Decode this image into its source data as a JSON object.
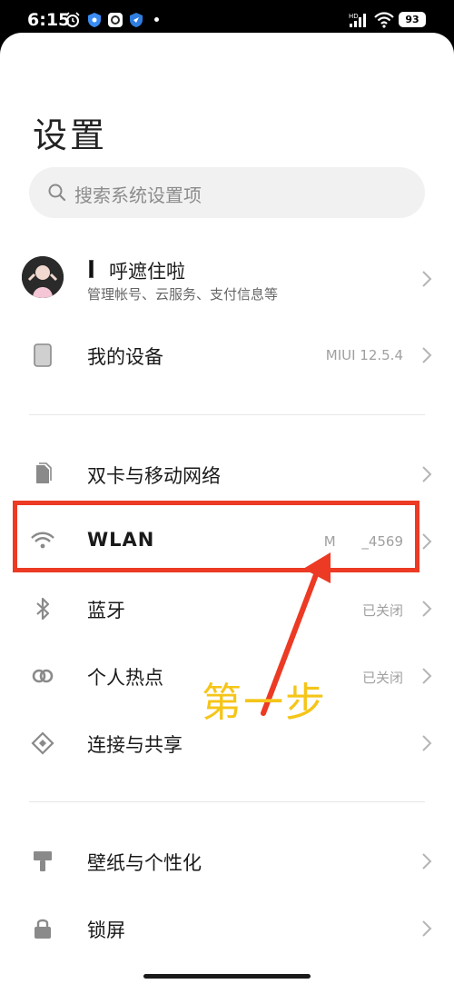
{
  "status_bar": {
    "time": "6:15",
    "signal_label": "HD",
    "battery": "93"
  },
  "page": {
    "title": "设置"
  },
  "search": {
    "placeholder": "搜索系统设置项"
  },
  "account": {
    "name": "呼遮住啦",
    "subtitle": "管理帐号、云服务、支付信息等"
  },
  "items": [
    {
      "label": "我的设备",
      "value": "MIUI 12.5.4",
      "icon": "phone-icon"
    },
    {
      "label": "双卡与移动网络",
      "value": "",
      "icon": "sim-card-icon"
    },
    {
      "label": "WLAN",
      "value": "M      _4569",
      "icon": "wifi-icon"
    },
    {
      "label": "蓝牙",
      "value": "已关闭",
      "icon": "bluetooth-icon"
    },
    {
      "label": "个人热点",
      "value": "已关闭",
      "icon": "hotspot-icon"
    },
    {
      "label": "连接与共享",
      "value": "",
      "icon": "share-icon"
    },
    {
      "label": "壁纸与个性化",
      "value": "",
      "icon": "paint-brush-icon"
    },
    {
      "label": "锁屏",
      "value": "",
      "icon": "lock-icon"
    }
  ],
  "annotation": {
    "text": "第一步",
    "box_color": "#ec3a24",
    "text_color": "#f5c518"
  },
  "colors": {
    "background": "#ffffff",
    "status_bar": "#000000",
    "search_bg": "#f1f1f1",
    "icon_gray": "#8a8a8a"
  }
}
